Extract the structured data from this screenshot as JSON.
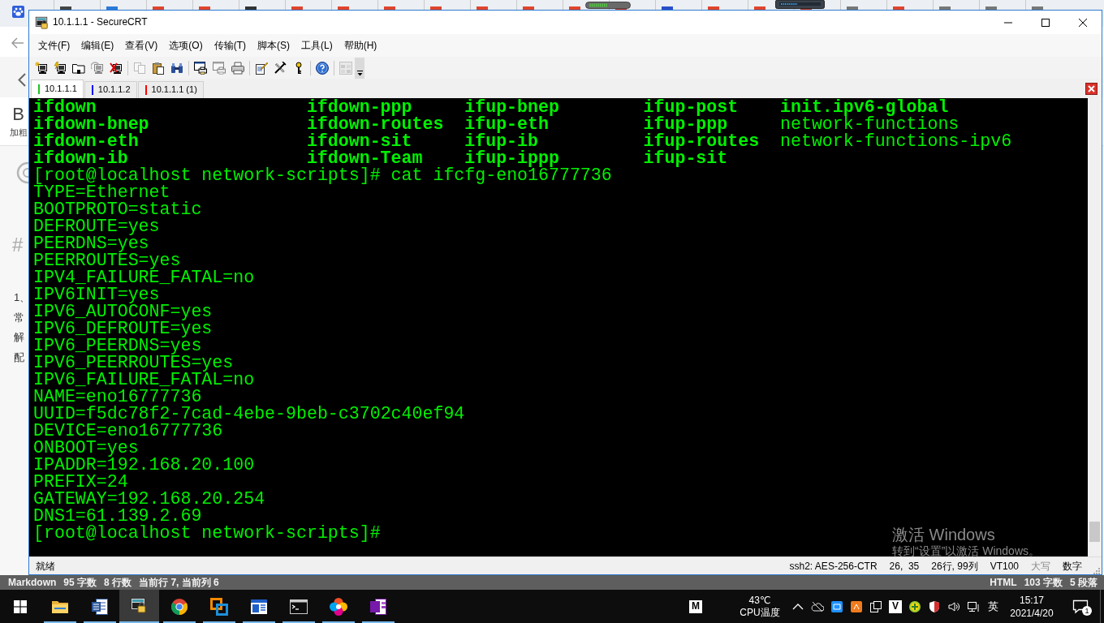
{
  "editor": {
    "bold_button": {
      "glyph": "B",
      "label": "加粗"
    },
    "heading_mark": "#",
    "text_fragments": [
      "1、",
      "常",
      "解",
      "配"
    ]
  },
  "window": {
    "title": "10.1.1.1 - SecureCRT"
  },
  "menu": [
    "文件(F)",
    "编辑(E)",
    "查看(V)",
    "选项(O)",
    "传输(T)",
    "脚本(S)",
    "工具(L)",
    "帮助(H)"
  ],
  "toolbar": [
    {
      "kind": "button",
      "disabled": false
    },
    {
      "kind": "button",
      "disabled": false
    },
    {
      "kind": "button",
      "disabled": false
    },
    {
      "kind": "button",
      "disabled": true
    },
    {
      "kind": "button",
      "disabled": false
    },
    {
      "kind": "separator"
    },
    {
      "kind": "button",
      "disabled": true
    },
    {
      "kind": "button",
      "disabled": false
    },
    {
      "kind": "button",
      "disabled": false
    },
    {
      "kind": "separator"
    },
    {
      "kind": "button",
      "disabled": false
    },
    {
      "kind": "button",
      "disabled": true
    },
    {
      "kind": "button",
      "disabled": false
    },
    {
      "kind": "separator"
    },
    {
      "kind": "button",
      "disabled": false
    },
    {
      "kind": "button",
      "disabled": false
    },
    {
      "kind": "button",
      "disabled": false
    },
    {
      "kind": "separator"
    },
    {
      "kind": "button",
      "disabled": false
    },
    {
      "kind": "separator"
    },
    {
      "kind": "button",
      "disabled": true
    }
  ],
  "tabs": [
    {
      "label": "10.1.1.1",
      "color": "#1ec41e",
      "selected": true
    },
    {
      "label": "10.1.1.2",
      "color": "#0000ff",
      "selected": false
    },
    {
      "label": "10.1.1.1 (1)",
      "color": "#ff0000",
      "selected": false
    }
  ],
  "terminal": {
    "lines": [
      {
        "kind": "columns",
        "cells": [
          {
            "text": "ifdown",
            "bold": true
          },
          {
            "text": "ifdown-ppp",
            "bold": true
          },
          {
            "text": "ifup-bnep",
            "bold": true
          },
          {
            "text": "ifup-post",
            "bold": true
          },
          {
            "text": "init.ipv6-global",
            "bold": true
          }
        ]
      },
      {
        "kind": "columns",
        "cells": [
          {
            "text": "ifdown-bnep",
            "bold": true
          },
          {
            "text": "ifdown-routes",
            "bold": true
          },
          {
            "text": "ifup-eth",
            "bold": true
          },
          {
            "text": "ifup-ppp",
            "bold": true
          },
          {
            "text": "network-functions",
            "bold": false
          }
        ]
      },
      {
        "kind": "columns",
        "cells": [
          {
            "text": "ifdown-eth",
            "bold": true
          },
          {
            "text": "ifdown-sit",
            "bold": true
          },
          {
            "text": "ifup-ib",
            "bold": true
          },
          {
            "text": "ifup-routes",
            "bold": true
          },
          {
            "text": "network-functions-ipv6",
            "bold": false
          }
        ]
      },
      {
        "kind": "columns",
        "cells": [
          {
            "text": "ifdown-ib",
            "bold": true
          },
          {
            "text": "ifdown-Team",
            "bold": true
          },
          {
            "text": "ifup-ippp",
            "bold": true
          },
          {
            "text": "ifup-sit",
            "bold": true
          }
        ]
      },
      {
        "kind": "text",
        "text": "[root@localhost network-scripts]# cat ifcfg-eno16777736"
      },
      {
        "kind": "text",
        "text": "TYPE=Ethernet"
      },
      {
        "kind": "text",
        "text": "BOOTPROTO=static"
      },
      {
        "kind": "text",
        "text": "DEFROUTE=yes"
      },
      {
        "kind": "text",
        "text": "PEERDNS=yes"
      },
      {
        "kind": "text",
        "text": "PEERROUTES=yes"
      },
      {
        "kind": "text",
        "text": "IPV4_FAILURE_FATAL=no"
      },
      {
        "kind": "text",
        "text": "IPV6INIT=yes"
      },
      {
        "kind": "text",
        "text": "IPV6_AUTOCONF=yes"
      },
      {
        "kind": "text",
        "text": "IPV6_DEFROUTE=yes"
      },
      {
        "kind": "text",
        "text": "IPV6_PEERDNS=yes"
      },
      {
        "kind": "text",
        "text": "IPV6_PEERROUTES=yes"
      },
      {
        "kind": "text",
        "text": "IPV6_FAILURE_FATAL=no"
      },
      {
        "kind": "text",
        "text": "NAME=eno16777736"
      },
      {
        "kind": "text",
        "text": "UUID=f5dc78f2-7cad-4ebe-9beb-c3702c40ef94"
      },
      {
        "kind": "text",
        "text": "DEVICE=eno16777736"
      },
      {
        "kind": "text",
        "text": "ONBOOT=yes"
      },
      {
        "kind": "text",
        "text": "IPADDR=192.168.20.100"
      },
      {
        "kind": "text",
        "text": "PREFIX=24"
      },
      {
        "kind": "text",
        "text": "GATEWAY=192.168.20.254"
      },
      {
        "kind": "text",
        "text": "DNS1=61.139.2.69"
      },
      {
        "kind": "text",
        "text": "[root@localhost network-scripts]#"
      }
    ]
  },
  "activation_notice": {
    "title": "激活 Windows",
    "hint": "转到“设置”以激活 Windows。"
  },
  "status_bar": {
    "message": "就绪",
    "panes": [
      "ssh2: AES-256-CTR",
      "26,  35",
      "26行, 99列",
      "VT100"
    ],
    "indicators": [
      {
        "label": "大写",
        "on": false
      },
      {
        "label": "数字",
        "on": true
      }
    ]
  },
  "editor_status": {
    "left": [
      "Markdown",
      "95 字数",
      "8 行数",
      "当前行 7, 当前列 6"
    ],
    "right": [
      "HTML",
      "103 字数",
      "5 段落"
    ]
  },
  "taskbar": {
    "apps": [
      {
        "running": true,
        "selected": false
      },
      {
        "running": true,
        "selected": false
      },
      {
        "running": true,
        "selected": true
      },
      {
        "running": true,
        "selected": false
      },
      {
        "running": true,
        "selected": false
      },
      {
        "running": true,
        "selected": false
      },
      {
        "running": true,
        "selected": false
      },
      {
        "running": true,
        "selected": false
      },
      {
        "running": true,
        "selected": false
      }
    ],
    "tray_letter_left": "M",
    "cpu_temperature": "43℃",
    "cpu_temperature_label": "CPU温度",
    "tray_letter_right": "V",
    "input_method": "英",
    "time": "15:17",
    "date": "2021/4/20",
    "notification_count": "1"
  }
}
